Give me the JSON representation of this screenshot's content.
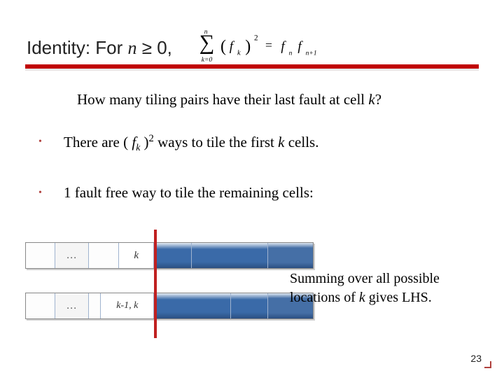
{
  "title": {
    "prefix": "Identity: For ",
    "var": "n",
    "suffix": " ≥ 0,"
  },
  "formula": {
    "sum_lower": "k=0",
    "sum_upper": "n",
    "lparen": "(",
    "term_base": "f",
    "term_sub": "k",
    "rparen": ")",
    "exp": "2",
    "eq": "=",
    "rhs1_base": "f",
    "rhs1_sub": "n",
    "rhs2_base": "f",
    "rhs2_sub": "n+1"
  },
  "question": {
    "pre": "How many tiling pairs have their last fault at cell ",
    "k": "k",
    "post": "?"
  },
  "bullets": {
    "b1": {
      "pre": "There are ( ",
      "f": "f",
      "k": "k",
      "mid": " )",
      "exp": "2",
      "post": " ways to tile the first ",
      "k2": "k",
      "post2": " cells."
    },
    "b2": {
      "text": "1 fault free way to tile the remaining cells:"
    }
  },
  "diagram": {
    "dots": "…",
    "top_label": "k",
    "bot_label": "k-1, k"
  },
  "summing": {
    "pre": "Summing over all possible locations of ",
    "k": "k ",
    "post": "gives LHS."
  },
  "page": "23"
}
